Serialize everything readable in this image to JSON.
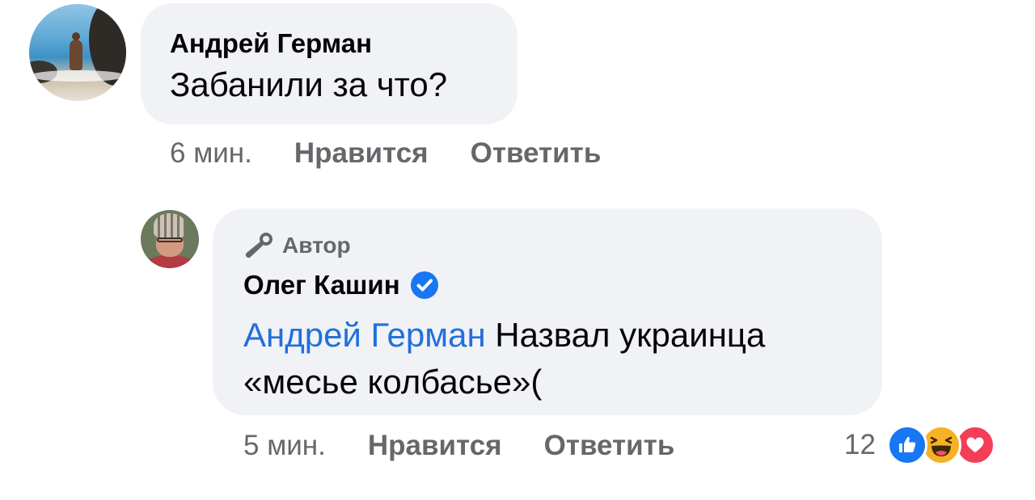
{
  "comment": {
    "author": "Андрей Герман",
    "text": "Забанили за что?",
    "time": "6 мин.",
    "like_label": "Нравится",
    "reply_label": "Ответить"
  },
  "reply": {
    "badge": "Автор",
    "author": "Олег Кашин",
    "mention": "Андрей Герман",
    "text_line1": " Назвал украинца",
    "text_line2": "«месье колбасье»(",
    "time": "5 мин.",
    "like_label": "Нравится",
    "reply_label": "Ответить",
    "reaction_count": "12",
    "reactions": [
      "like-icon",
      "haha-icon",
      "love-icon"
    ]
  },
  "colors": {
    "bubble": "#f0f2f5",
    "meta_text": "#65676b",
    "mention": "#216fdb",
    "verified": "#1877f2"
  }
}
